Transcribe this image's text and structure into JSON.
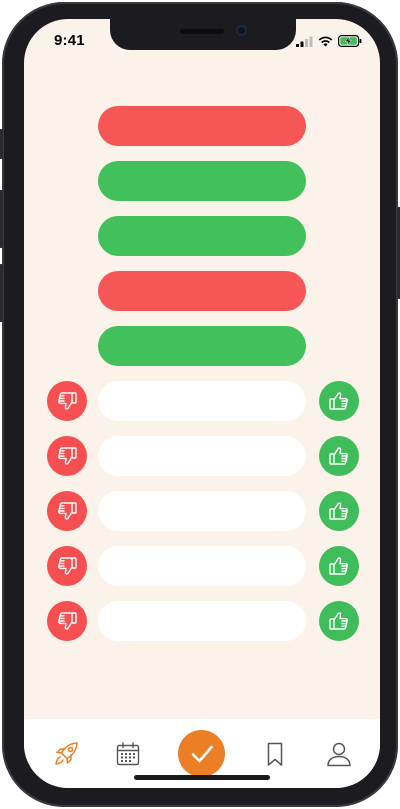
{
  "status_bar": {
    "time": "9:41",
    "signal_icon": "cellular-signal-icon",
    "wifi_icon": "wifi-icon",
    "battery_icon": "battery-charging-icon"
  },
  "result_bars": [
    {
      "status": "incorrect",
      "color": "#f75656"
    },
    {
      "status": "correct",
      "color": "#41c05b"
    },
    {
      "status": "correct",
      "color": "#41c05b"
    },
    {
      "status": "incorrect",
      "color": "#f75656"
    },
    {
      "status": "correct",
      "color": "#41c05b"
    }
  ],
  "vote_rows": [
    {
      "left_icon": "thumbs-down-icon",
      "right_icon": "thumbs-up-icon",
      "text": ""
    },
    {
      "left_icon": "thumbs-down-icon",
      "right_icon": "thumbs-up-icon",
      "text": ""
    },
    {
      "left_icon": "thumbs-down-icon",
      "right_icon": "thumbs-up-icon",
      "text": ""
    },
    {
      "left_icon": "thumbs-down-icon",
      "right_icon": "thumbs-up-icon",
      "text": ""
    },
    {
      "left_icon": "thumbs-down-icon",
      "right_icon": "thumbs-up-icon",
      "text": ""
    }
  ],
  "tab_bar": {
    "items": [
      {
        "icon": "rocket-icon",
        "active": true
      },
      {
        "icon": "calendar-icon",
        "active": false
      },
      {
        "icon": "checkmark-icon",
        "active": false,
        "primary": true
      },
      {
        "icon": "bookmark-icon",
        "active": false
      },
      {
        "icon": "profile-icon",
        "active": false
      }
    ]
  },
  "colors": {
    "background": "#fbf2e9",
    "red": "#f75656",
    "green": "#41c05b",
    "accent": "#ec7f25",
    "tab_icon": "#555555"
  }
}
